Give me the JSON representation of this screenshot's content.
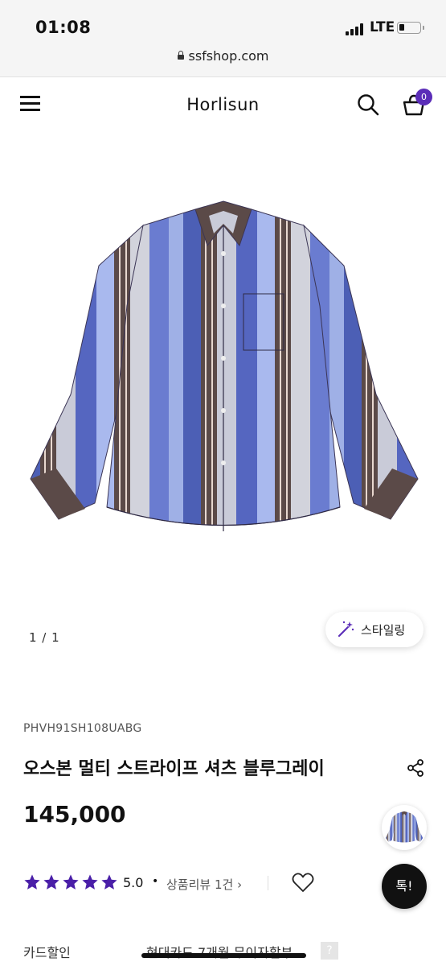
{
  "status_bar": {
    "time": "01:08",
    "network": "LTE",
    "url": "ssfshop.com"
  },
  "header": {
    "brand": "Horlisun",
    "cart_count": "0"
  },
  "gallery": {
    "pager": "1 / 1",
    "styling_label": "스타일링"
  },
  "product": {
    "code": "PHVH91SH108UABG",
    "name": "오스본 멀티 스트라이프 셔츠 블루그레이",
    "price": "145,000",
    "rating": "5.0",
    "stars": 5,
    "review_link": "상품리뷰 1건 ›"
  },
  "chat": {
    "label": "톡!"
  },
  "card": {
    "label": "카드할인",
    "value": "현대카드 7개월 무이자할부",
    "help": "?"
  },
  "colors": {
    "accent": "#5b2db8",
    "star": "#4a1fa8",
    "chat_bg": "#111111"
  }
}
